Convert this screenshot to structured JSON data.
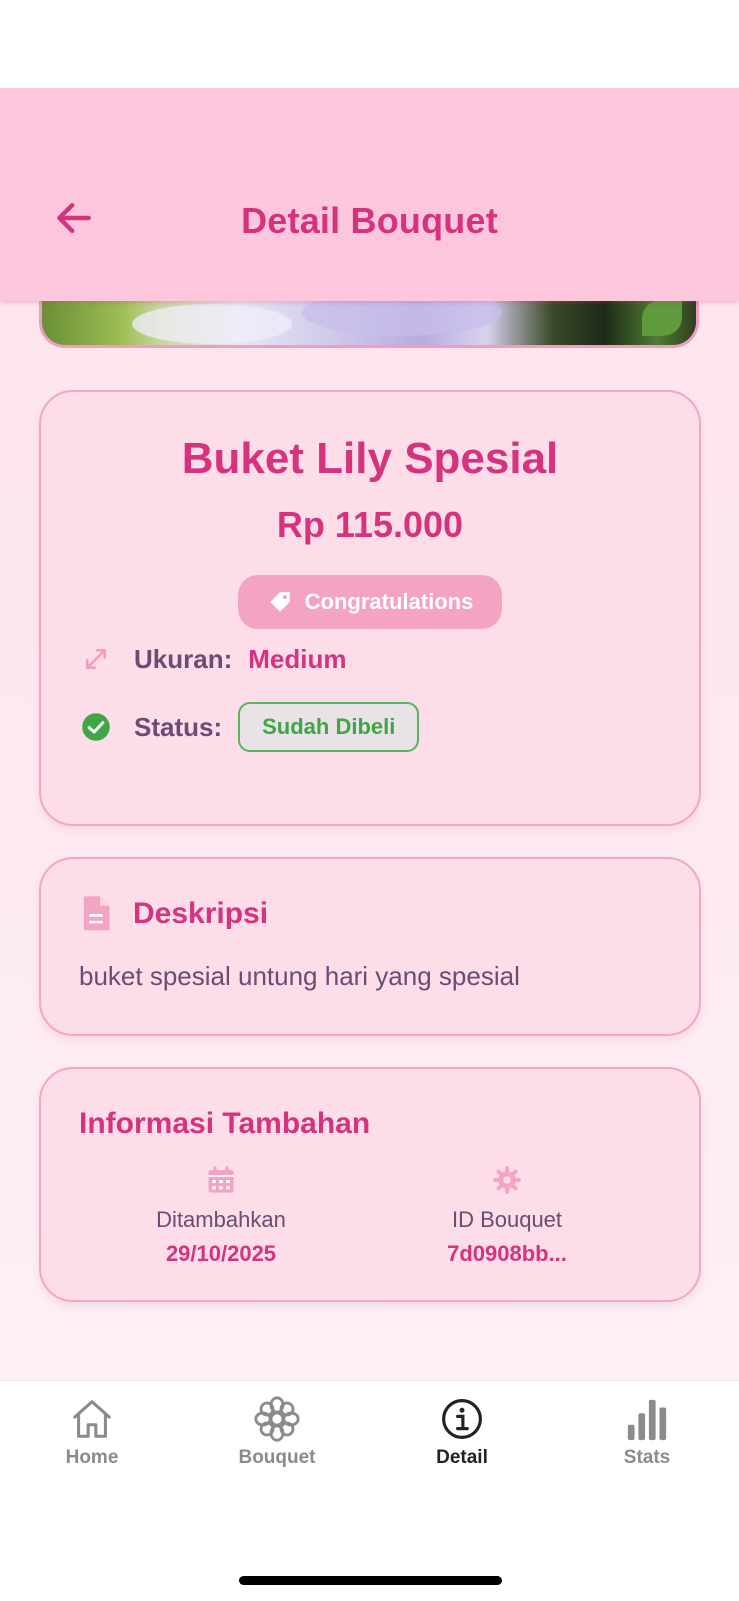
{
  "app_bar": {
    "title": "Detail Bouquet"
  },
  "bouquet": {
    "name": "Buket Lily Spesial",
    "price": "Rp 115.000",
    "occasion": "Congratulations",
    "size_label": "Ukuran:",
    "size_value": "Medium",
    "status_label": "Status:",
    "status_value": "Sudah Dibeli"
  },
  "description": {
    "title": "Deskripsi",
    "text": "buket spesial untung hari yang spesial"
  },
  "info": {
    "title": "Informasi Tambahan",
    "added_label": "Ditambahkan",
    "added_value": "29/10/2025",
    "id_label": "ID Bouquet",
    "id_value": "7d0908bb..."
  },
  "nav": {
    "items": [
      {
        "label": "Home",
        "icon": "home-icon"
      },
      {
        "label": "Bouquet",
        "icon": "flower-icon"
      },
      {
        "label": "Detail",
        "icon": "info-icon",
        "active": true
      },
      {
        "label": "Stats",
        "icon": "bar-chart-icon"
      }
    ]
  },
  "colors": {
    "primary": "#d6337f",
    "app_bar_bg": "#fcc6dd",
    "card_bg": "#fddde8",
    "status_green": "#3fa646"
  }
}
